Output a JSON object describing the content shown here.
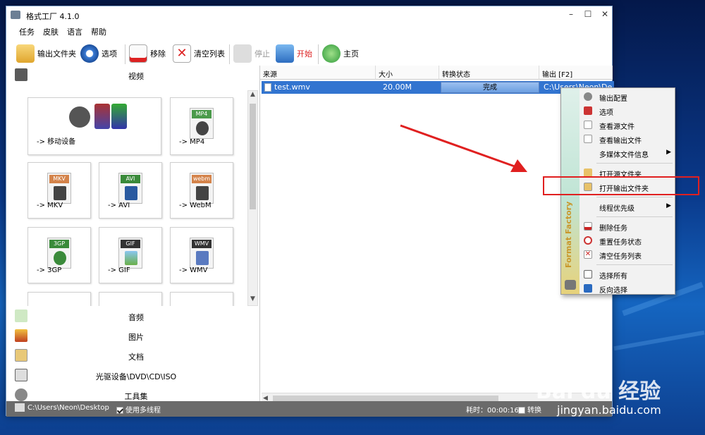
{
  "window": {
    "title": "格式工厂 4.1.0",
    "min": "–",
    "max": "☐",
    "close": "✕"
  },
  "menubar": [
    "任务",
    "皮肤",
    "语言",
    "帮助"
  ],
  "toolbar": {
    "output_folder": "输出文件夹",
    "options": "选项",
    "remove": "移除",
    "clear_list": "清空列表",
    "stop": "停止",
    "start": "开始",
    "home": "主页"
  },
  "left": {
    "video_title": "视频",
    "tiles": [
      {
        "label": "-> 移动设备",
        "tag": ""
      },
      {
        "label": "-> MP4",
        "tag": "MP4"
      },
      {
        "label": "-> MKV",
        "tag": "MKV"
      },
      {
        "label": "-> AVI",
        "tag": "AVI"
      },
      {
        "label": "-> WebM",
        "tag": "webm"
      },
      {
        "label": "-> 3GP",
        "tag": "3GP"
      },
      {
        "label": "-> GIF",
        "tag": "GIF"
      },
      {
        "label": "-> WMV",
        "tag": "WMV"
      }
    ],
    "categories": [
      "音频",
      "图片",
      "文档",
      "光驱设备\\DVD\\CD\\ISO",
      "工具集"
    ]
  },
  "table": {
    "headers": [
      "来源",
      "大小",
      "转换状态",
      "输出 [F2]"
    ],
    "rows": [
      {
        "source": "test.wmv",
        "size": "20.00M",
        "status": "完成",
        "output": "C:\\Users\\Neon\\De"
      }
    ]
  },
  "status": {
    "path": "C:\\Users\\Neon\\Desktop",
    "multithread": "使用多线程",
    "elapsed_label": "耗时：00:00:16",
    "convert_tail": "转换"
  },
  "context_menu": {
    "brand": "Format Factory",
    "items": [
      {
        "label": "输出配置",
        "has_sub": false
      },
      {
        "label": "选项",
        "has_sub": false
      },
      {
        "label": "查看源文件",
        "has_sub": false
      },
      {
        "label": "查看输出文件",
        "has_sub": false
      },
      {
        "label": "多媒体文件信息",
        "has_sub": true
      },
      {
        "label": "打开源文件夹",
        "has_sub": false
      },
      {
        "label": "打开输出文件夹",
        "has_sub": false
      },
      {
        "label": "线程优先级",
        "has_sub": true
      },
      {
        "label": "删除任务",
        "has_sub": false
      },
      {
        "label": "重置任务状态",
        "has_sub": false
      },
      {
        "label": "清空任务列表",
        "has_sub": false
      },
      {
        "label": "选择所有",
        "has_sub": false
      },
      {
        "label": "反向选择",
        "has_sub": false
      }
    ]
  },
  "watermark": {
    "main": "Bai du 经验",
    "sub": "jingyan.baidu.com"
  },
  "colors": {
    "selection": "#3274d0",
    "highlight_box": "#e02020",
    "arrow": "#e02020"
  }
}
